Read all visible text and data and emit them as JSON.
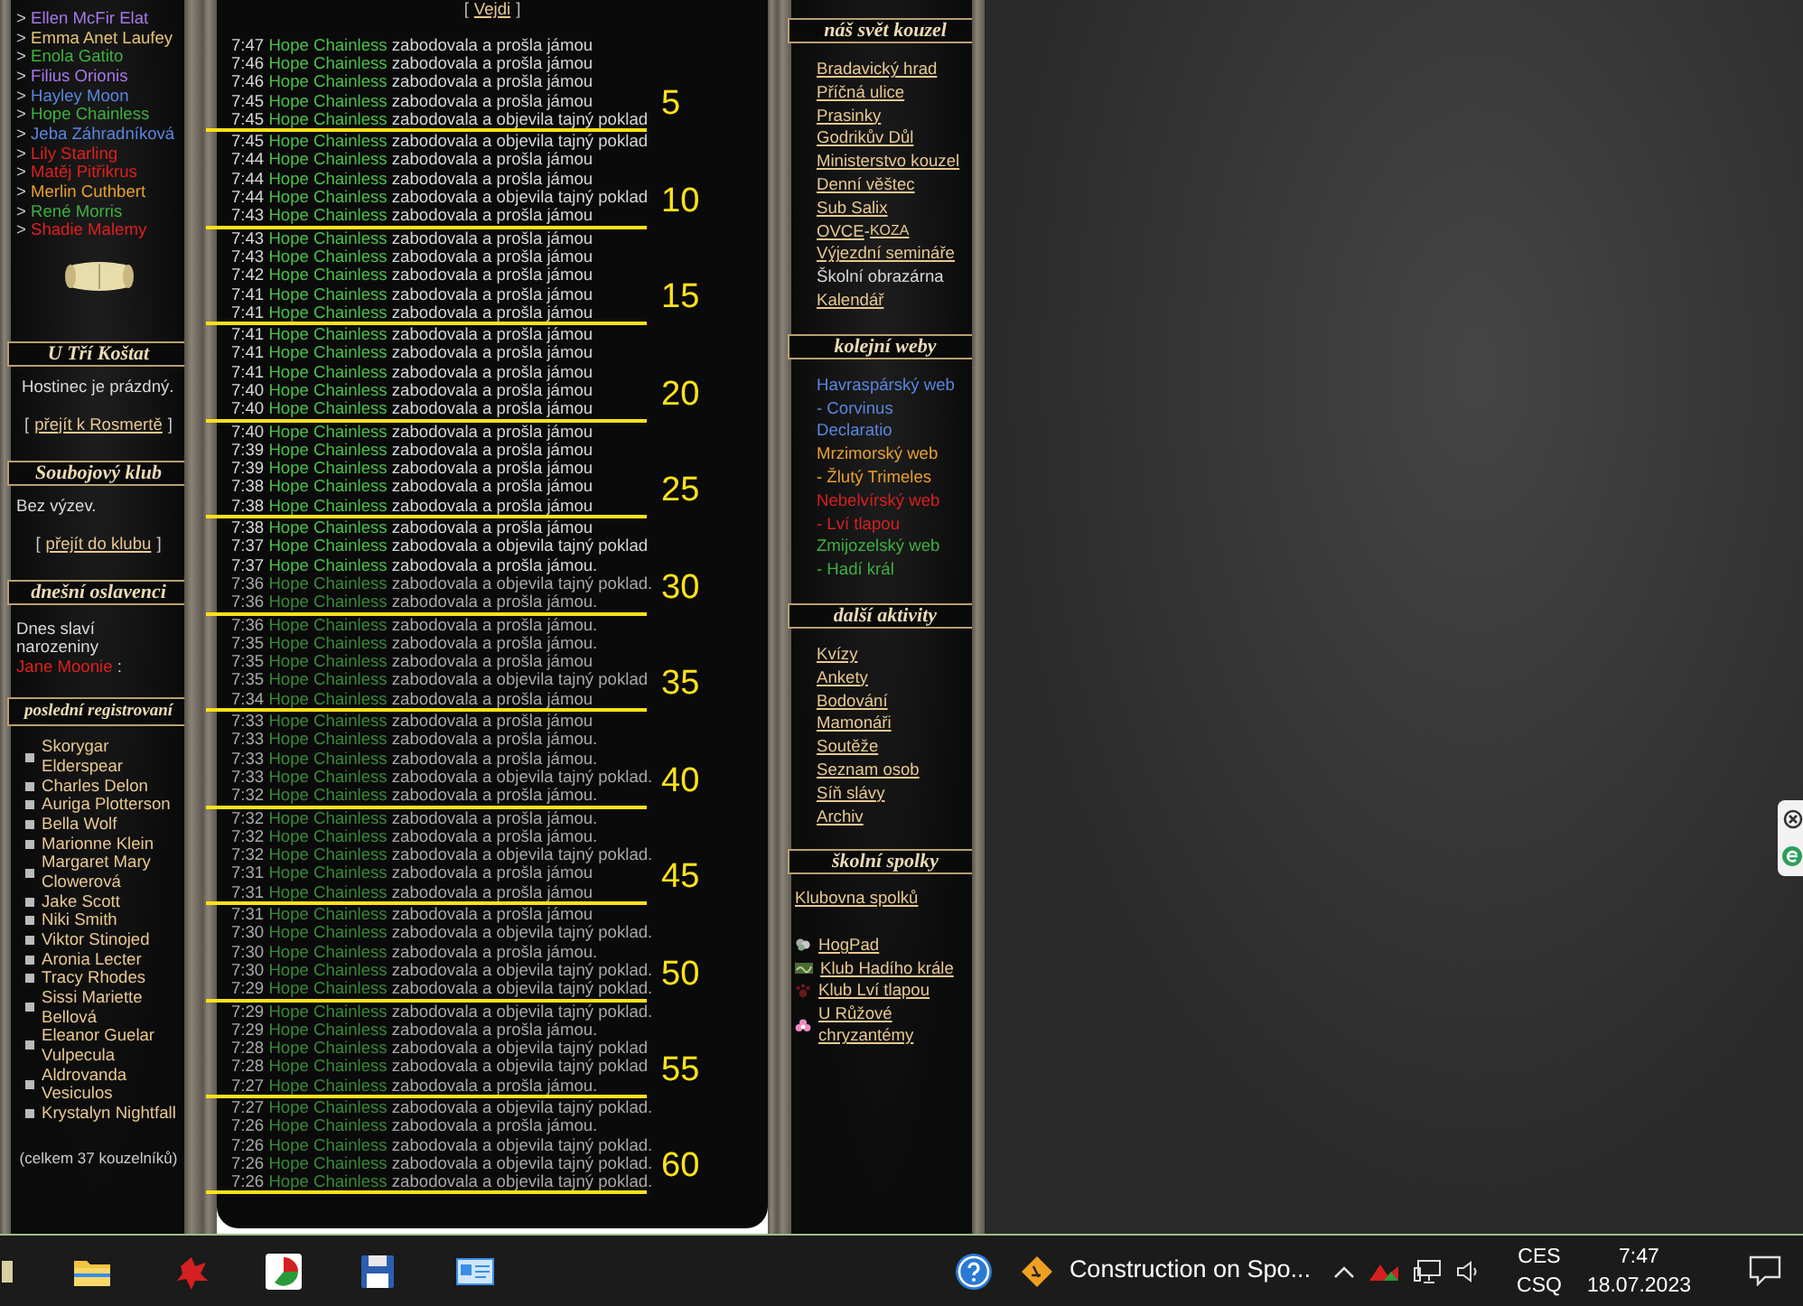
{
  "online_users": [
    {
      "prefix": ">",
      "name": "Ellen McFir Elat",
      "color": "#a678e8"
    },
    {
      "prefix": ">",
      "name": "Emma Anet Laufey",
      "color": "#e8c478"
    },
    {
      "prefix": ">",
      "name": "Enola Gatito",
      "color": "#3fb03f"
    },
    {
      "prefix": ">",
      "name": "Filius Orionis",
      "color": "#a678e8"
    },
    {
      "prefix": ">",
      "name": "Hayley Moon",
      "color": "#5a86e0"
    },
    {
      "prefix": ">",
      "name": "Hope Chainless",
      "color": "#3fb03f"
    },
    {
      "prefix": ">",
      "name": "Jeba Záhradníková",
      "color": "#5a86e0"
    },
    {
      "prefix": ">",
      "name": "Lily Starling",
      "color": "#e02020"
    },
    {
      "prefix": ">",
      "name": "Matěj Pitřikrus",
      "color": "#e02020"
    },
    {
      "prefix": ">",
      "name": "Merlin Cuthbert",
      "color": "#e8a030"
    },
    {
      "prefix": ">",
      "name": "René Morris",
      "color": "#3fb03f"
    },
    {
      "prefix": ">",
      "name": "Shadie Malemy",
      "color": "#e02020"
    }
  ],
  "tavern": {
    "title": "U Tří Koštat",
    "text": "Hostinec je prázdný.",
    "brackets": [
      "[",
      "]"
    ],
    "link": "přejít k Rosmertě"
  },
  "duel_club": {
    "title": "Soubojový klub",
    "text": "Bez výzev.",
    "brackets": [
      "[",
      "]"
    ],
    "link": "přejít do klubu"
  },
  "birthdays": {
    "title": "dnešní oslavenci",
    "text": "Dnes slaví narozeniny",
    "name": "Jane Moonie",
    "after": ":"
  },
  "registrations": {
    "title": "poslední registrovaní",
    "items": [
      "Skorygar Elderspear",
      "Charles Delon",
      "Auriga Plotterson",
      "Bella Wolf",
      "Marionne Klein",
      "Margaret Mary Clowerová",
      "Jake Scott",
      "Niki Smith",
      "Viktor Stinojed",
      "Aronia Lecter",
      "Tracy Rhodes",
      "Sissi Mariette Bellová",
      "Eleanor Guelar Vulpecula",
      "Aldrovanda Vesiculos",
      "Krystalyn Nightfall"
    ],
    "total": "(celkem 37 kouzelníků)"
  },
  "log": {
    "brackets": [
      "[",
      "]"
    ],
    "enter_link": "Vejdi",
    "entries": [
      {
        "time": "7:47",
        "name": "Hope Chainless",
        "action": "zabodovala a prošla jámou",
        "faded": false
      },
      {
        "time": "7:46",
        "name": "Hope Chainless",
        "action": "zabodovala a prošla jámou",
        "faded": false
      },
      {
        "time": "7:46",
        "name": "Hope Chainless",
        "action": "zabodovala a prošla jámou",
        "faded": false
      },
      {
        "time": "7:45",
        "name": "Hope Chainless",
        "action": "zabodovala a prošla jámou",
        "faded": false
      },
      {
        "time": "7:45",
        "name": "Hope Chainless",
        "action": "zabodovala a objevila tajný poklad",
        "faded": false,
        "annotation": "5"
      },
      {
        "time": "7:45",
        "name": "Hope Chainless",
        "action": "zabodovala a objevila tajný poklad",
        "faded": false
      },
      {
        "time": "7:44",
        "name": "Hope Chainless",
        "action": "zabodovala a prošla jámou",
        "faded": false
      },
      {
        "time": "7:44",
        "name": "Hope Chainless",
        "action": "zabodovala a prošla jámou",
        "faded": false
      },
      {
        "time": "7:44",
        "name": "Hope Chainless",
        "action": "zabodovala a objevila tajný poklad",
        "faded": false
      },
      {
        "time": "7:43",
        "name": "Hope Chainless",
        "action": "zabodovala a prošla jámou",
        "faded": false,
        "annotation": "10"
      },
      {
        "time": "7:43",
        "name": "Hope Chainless",
        "action": "zabodovala a prošla jámou",
        "faded": false
      },
      {
        "time": "7:43",
        "name": "Hope Chainless",
        "action": "zabodovala a prošla jámou",
        "faded": false
      },
      {
        "time": "7:42",
        "name": "Hope Chainless",
        "action": "zabodovala a prošla jámou",
        "faded": false
      },
      {
        "time": "7:41",
        "name": "Hope Chainless",
        "action": "zabodovala a prošla jámou",
        "faded": false
      },
      {
        "time": "7:41",
        "name": "Hope Chainless",
        "action": "zabodovala a prošla jámou",
        "faded": false,
        "annotation": "15"
      },
      {
        "time": "7:41",
        "name": "Hope Chainless",
        "action": "zabodovala a prošla jámou",
        "faded": false
      },
      {
        "time": "7:41",
        "name": "Hope Chainless",
        "action": "zabodovala a prošla jámou",
        "faded": false
      },
      {
        "time": "7:41",
        "name": "Hope Chainless",
        "action": "zabodovala a prošla jámou",
        "faded": false
      },
      {
        "time": "7:40",
        "name": "Hope Chainless",
        "action": "zabodovala a prošla jámou",
        "faded": false
      },
      {
        "time": "7:40",
        "name": "Hope Chainless",
        "action": "zabodovala a prošla jámou",
        "faded": false,
        "annotation": "20"
      },
      {
        "time": "7:40",
        "name": "Hope Chainless",
        "action": "zabodovala a prošla jámou",
        "faded": false
      },
      {
        "time": "7:39",
        "name": "Hope Chainless",
        "action": "zabodovala a prošla jámou",
        "faded": false
      },
      {
        "time": "7:39",
        "name": "Hope Chainless",
        "action": "zabodovala a prošla jámou",
        "faded": false
      },
      {
        "time": "7:38",
        "name": "Hope Chainless",
        "action": "zabodovala a prošla jámou",
        "faded": false
      },
      {
        "time": "7:38",
        "name": "Hope Chainless",
        "action": "zabodovala a prošla jámou",
        "faded": false,
        "annotation": "25"
      },
      {
        "time": "7:38",
        "name": "Hope Chainless",
        "action": "zabodovala a prošla jámou",
        "faded": false
      },
      {
        "time": "7:37",
        "name": "Hope Chainless",
        "action": "zabodovala a objevila tajný poklad",
        "faded": false
      },
      {
        "time": "7:37",
        "name": "Hope Chainless",
        "action": "zabodovala a prošla jámou.",
        "faded": false
      },
      {
        "time": "7:36",
        "name": "Hope Chainless",
        "action": "zabodovala a objevila tajný poklad.",
        "faded": true
      },
      {
        "time": "7:36",
        "name": "Hope Chainless",
        "action": "zabodovala a prošla jámou.",
        "faded": true,
        "annotation": "30"
      },
      {
        "time": "7:36",
        "name": "Hope Chainless",
        "action": "zabodovala a prošla jámou.",
        "faded": true
      },
      {
        "time": "7:35",
        "name": "Hope Chainless",
        "action": "zabodovala a prošla jámou.",
        "faded": true
      },
      {
        "time": "7:35",
        "name": "Hope Chainless",
        "action": "zabodovala a prošla jámou",
        "faded": true
      },
      {
        "time": "7:35",
        "name": "Hope Chainless",
        "action": "zabodovala a objevila tajný poklad",
        "faded": true
      },
      {
        "time": "7:34",
        "name": "Hope Chainless",
        "action": "zabodovala a prošla jámou",
        "faded": true,
        "annotation": "35"
      },
      {
        "time": "7:33",
        "name": "Hope Chainless",
        "action": "zabodovala a prošla jámou",
        "faded": true
      },
      {
        "time": "7:33",
        "name": "Hope Chainless",
        "action": "zabodovala a prošla jámou.",
        "faded": true
      },
      {
        "time": "7:33",
        "name": "Hope Chainless",
        "action": "zabodovala a prošla jámou.",
        "faded": true
      },
      {
        "time": "7:33",
        "name": "Hope Chainless",
        "action": "zabodovala a objevila tajný poklad.",
        "faded": true
      },
      {
        "time": "7:32",
        "name": "Hope Chainless",
        "action": "zabodovala a prošla jámou.",
        "faded": true,
        "annotation": "40"
      },
      {
        "time": "7:32",
        "name": "Hope Chainless",
        "action": "zabodovala a prošla jámou.",
        "faded": true
      },
      {
        "time": "7:32",
        "name": "Hope Chainless",
        "action": "zabodovala a prošla jámou.",
        "faded": true
      },
      {
        "time": "7:32",
        "name": "Hope Chainless",
        "action": "zabodovala a objevila tajný poklad.",
        "faded": true
      },
      {
        "time": "7:31",
        "name": "Hope Chainless",
        "action": "zabodovala a prošla jámou",
        "faded": true
      },
      {
        "time": "7:31",
        "name": "Hope Chainless",
        "action": "zabodovala a prošla jámou",
        "faded": true,
        "annotation": "45"
      },
      {
        "time": "7:31",
        "name": "Hope Chainless",
        "action": "zabodovala a prošla jámou",
        "faded": true
      },
      {
        "time": "7:30",
        "name": "Hope Chainless",
        "action": "zabodovala a objevila tajný poklad.",
        "faded": true
      },
      {
        "time": "7:30",
        "name": "Hope Chainless",
        "action": "zabodovala a prošla jámou.",
        "faded": true
      },
      {
        "time": "7:30",
        "name": "Hope Chainless",
        "action": "zabodovala a objevila tajný poklad.",
        "faded": true
      },
      {
        "time": "7:29",
        "name": "Hope Chainless",
        "action": "zabodovala a objevila tajný poklad.",
        "faded": true,
        "annotation": "50"
      },
      {
        "time": "7:29",
        "name": "Hope Chainless",
        "action": "zabodovala a objevila tajný poklad.",
        "faded": true
      },
      {
        "time": "7:29",
        "name": "Hope Chainless",
        "action": "zabodovala a prošla jámou.",
        "faded": true
      },
      {
        "time": "7:28",
        "name": "Hope Chainless",
        "action": "zabodovala a objevila tajný poklad",
        "faded": true
      },
      {
        "time": "7:28",
        "name": "Hope Chainless",
        "action": "zabodovala a objevila tajný poklad",
        "faded": true
      },
      {
        "time": "7:27",
        "name": "Hope Chainless",
        "action": "zabodovala a prošla jámou.",
        "faded": true,
        "annotation": "55"
      },
      {
        "time": "7:27",
        "name": "Hope Chainless",
        "action": "zabodovala a objevila tajný poklad.",
        "faded": true
      },
      {
        "time": "7:26",
        "name": "Hope Chainless",
        "action": "zabodovala a prošla jámou.",
        "faded": true
      },
      {
        "time": "7:26",
        "name": "Hope Chainless",
        "action": "zabodovala a objevila tajný poklad.",
        "faded": true
      },
      {
        "time": "7:26",
        "name": "Hope Chainless",
        "action": "zabodovala a objevila tajný poklad.",
        "faded": true
      },
      {
        "time": "7:26",
        "name": "Hope Chainless",
        "action": "zabodovala a objevila tajný poklad.",
        "faded": true,
        "annotation": "60"
      }
    ]
  },
  "nav_sections": [
    {
      "title": "náš svět kouzel",
      "items": [
        {
          "kind": "link",
          "label": "Bradavický hrad"
        },
        {
          "kind": "link",
          "label": "Příčná ulice"
        },
        {
          "kind": "link",
          "label": "Prasinky"
        },
        {
          "kind": "link",
          "label": "Godrikův Důl"
        },
        {
          "kind": "link",
          "label": "Ministerstvo kouzel"
        },
        {
          "kind": "link",
          "label": "Denní věštec"
        },
        {
          "kind": "link",
          "label": "Sub Salix"
        },
        {
          "kind": "pair",
          "label": "OVCE",
          "separator": "-",
          "label2": "KOZA"
        },
        {
          "kind": "link",
          "label": "Výjezdní semináře"
        },
        {
          "kind": "text",
          "label": "Školní obrazárna"
        },
        {
          "kind": "link",
          "label": "Kalendář"
        }
      ]
    },
    {
      "title": "kolejní weby",
      "items": [
        {
          "kind": "house",
          "label": "Havraspárský web",
          "color": "#5a86e0"
        },
        {
          "kind": "house",
          "label": "- Corvinus Declaratio",
          "color": "#5a86e0"
        },
        {
          "kind": "house",
          "label": "Mrzimorský web",
          "color": "#e8a030"
        },
        {
          "kind": "house",
          "label": "- Žlutý Trimeles",
          "color": "#e8a030"
        },
        {
          "kind": "house",
          "label": "Nebelvírský web",
          "color": "#d82020"
        },
        {
          "kind": "house",
          "label": "- Lví tlapou",
          "color": "#d82020"
        },
        {
          "kind": "house",
          "label": "Zmijozelský web",
          "color": "#3fb03f"
        },
        {
          "kind": "house",
          "label": "- Hadí král",
          "color": "#3fb03f"
        }
      ]
    },
    {
      "title": "další aktivity",
      "items": [
        {
          "kind": "link",
          "label": "Kvízy"
        },
        {
          "kind": "link",
          "label": "Ankety"
        },
        {
          "kind": "link",
          "label": "Bodování"
        },
        {
          "kind": "link",
          "label": "Mamonáři"
        },
        {
          "kind": "link",
          "label": "Soutěže"
        },
        {
          "kind": "link",
          "label": "Seznam osob"
        },
        {
          "kind": "link",
          "label": "Síň slávy"
        },
        {
          "kind": "link",
          "label": "Archiv"
        }
      ]
    },
    {
      "title": "školní spolky",
      "items": [
        {
          "kind": "hub",
          "label": "Klubovna spolků"
        },
        {
          "kind": "club",
          "label": "HogPad"
        },
        {
          "kind": "club",
          "label": "Klub Hadího krále"
        },
        {
          "kind": "club",
          "label": "Klub Lví tlapou"
        },
        {
          "kind": "club",
          "label": "U Růžové chryzantémy"
        }
      ]
    }
  ],
  "taskbar": {
    "task": "Construction on Spo...",
    "language": [
      "CES",
      "CSQ"
    ],
    "time": "7:47",
    "date": "18.07.2023"
  }
}
